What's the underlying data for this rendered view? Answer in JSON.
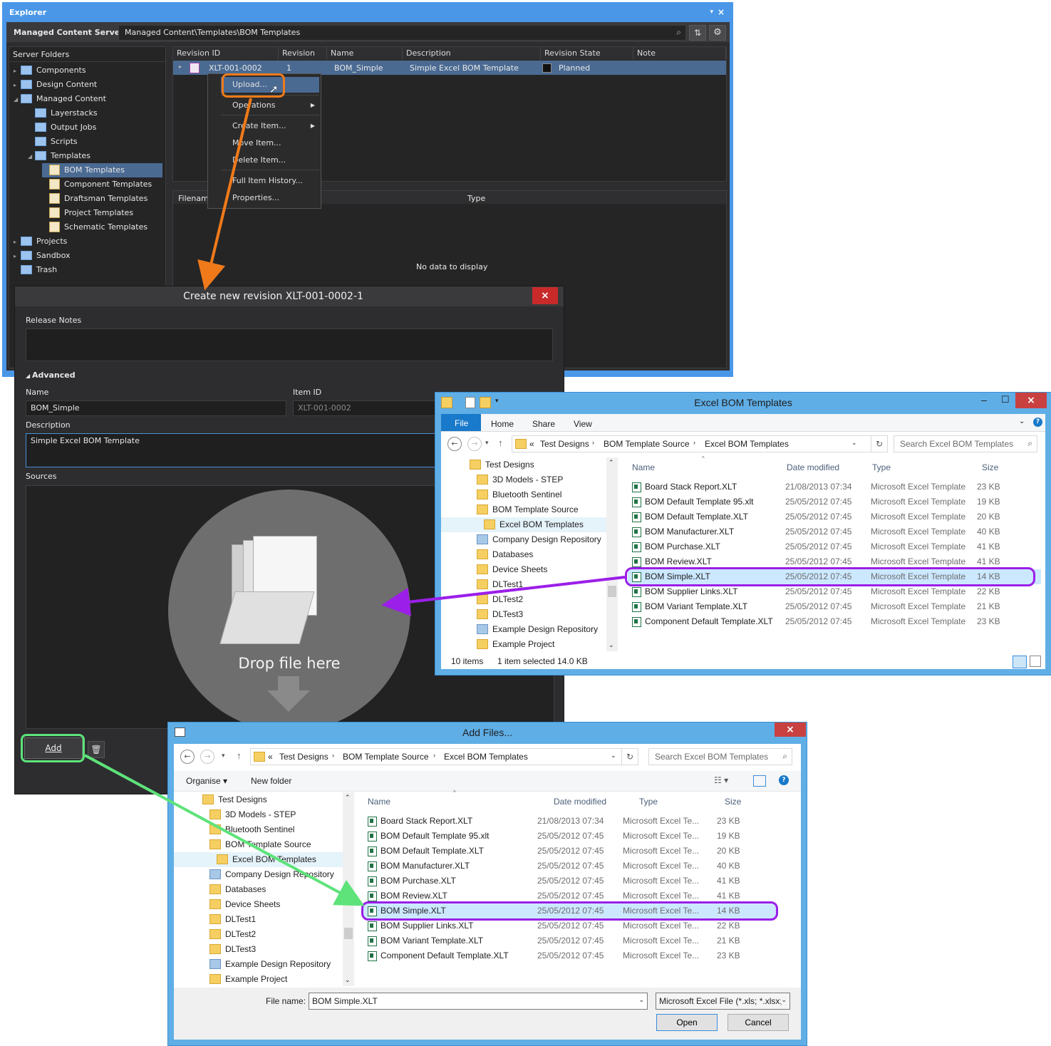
{
  "explorer": {
    "title": "Explorer",
    "server_label": "Managed Content Server ▾",
    "path": "Managed Content\\Templates\\BOM Templates",
    "server_folders_header": "Server Folders",
    "tree": [
      {
        "label": "Components",
        "level": 0
      },
      {
        "label": "Design Content",
        "level": 0
      },
      {
        "label": "Managed Content",
        "level": 0
      },
      {
        "label": "Layerstacks",
        "level": 1
      },
      {
        "label": "Output Jobs",
        "level": 1
      },
      {
        "label": "Scripts",
        "level": 1
      },
      {
        "label": "Templates",
        "level": 1
      },
      {
        "label": "BOM Templates",
        "level": 2
      },
      {
        "label": "Component Templates",
        "level": 2
      },
      {
        "label": "Draftsman Templates",
        "level": 2
      },
      {
        "label": "Project Templates",
        "level": 2
      },
      {
        "label": "Schematic Templates",
        "level": 2
      },
      {
        "label": "Projects",
        "level": 0
      },
      {
        "label": "Sandbox",
        "level": 0
      },
      {
        "label": "Trash",
        "level": 0
      }
    ],
    "columns": [
      "Revision ID",
      "Revision",
      "Name",
      "Description",
      "Revision State",
      "Note"
    ],
    "row": {
      "revision_id": "XLT-001-0002",
      "revision": "1",
      "name": "BOM_Simple",
      "description": "Simple Excel BOM Template",
      "state": "Planned"
    },
    "lower_columns": [
      "Filename",
      "Type"
    ],
    "no_data": "No data to display"
  },
  "context_menu": {
    "items": [
      "Upload...",
      "Operations",
      "Create Item...",
      "Move Item...",
      "Delete Item...",
      "Full Item History...",
      "Properties..."
    ]
  },
  "create_dialog": {
    "title": "Create new revision XLT-001-0002-1",
    "release_notes_label": "Release Notes",
    "advanced_label": "Advanced",
    "name_label": "Name",
    "name_value": "BOM_Simple",
    "item_id_label": "Item ID",
    "item_id_value": "XLT-001-0002",
    "description_label": "Description",
    "description_value": "Simple Excel BOM Template",
    "sources_label": "Sources",
    "drop_text": "Drop file here",
    "add_button": "Add"
  },
  "excel_window": {
    "title": "Excel BOM Templates",
    "ribbon_tabs": [
      "File",
      "Home",
      "Share",
      "View"
    ],
    "breadcrumb": [
      "«",
      "Test Designs",
      "BOM Template Source",
      "Excel BOM Templates"
    ],
    "search_placeholder": "Search Excel BOM Templates",
    "nav_tree": [
      "Test Designs",
      "3D Models - STEP",
      "Bluetooth Sentinel",
      "BOM Template Source",
      "Excel BOM Templates",
      "Company Design Repository",
      "Databases",
      "Device Sheets",
      "DLTest1",
      "DLTest2",
      "DLTest3",
      "Example Design Repository",
      "Example Project"
    ],
    "columns": [
      "Name",
      "Date modified",
      "Type",
      "Size"
    ],
    "files": [
      {
        "name": "Board Stack Report.XLT",
        "date": "21/08/2013 07:34",
        "type": "Microsoft Excel Template",
        "size": "23 KB"
      },
      {
        "name": "BOM Default Template 95.xlt",
        "date": "25/05/2012 07:45",
        "type": "Microsoft Excel Template",
        "size": "19 KB"
      },
      {
        "name": "BOM Default Template.XLT",
        "date": "25/05/2012 07:45",
        "type": "Microsoft Excel Template",
        "size": "20 KB"
      },
      {
        "name": "BOM Manufacturer.XLT",
        "date": "25/05/2012 07:45",
        "type": "Microsoft Excel Template",
        "size": "40 KB"
      },
      {
        "name": "BOM Purchase.XLT",
        "date": "25/05/2012 07:45",
        "type": "Microsoft Excel Template",
        "size": "41 KB"
      },
      {
        "name": "BOM Review.XLT",
        "date": "25/05/2012 07:45",
        "type": "Microsoft Excel Template",
        "size": "41 KB"
      },
      {
        "name": "BOM Simple.XLT",
        "date": "25/05/2012 07:45",
        "type": "Microsoft Excel Template",
        "size": "14 KB"
      },
      {
        "name": "BOM Supplier Links.XLT",
        "date": "25/05/2012 07:45",
        "type": "Microsoft Excel Template",
        "size": "22 KB"
      },
      {
        "name": "BOM Variant Template.XLT",
        "date": "25/05/2012 07:45",
        "type": "Microsoft Excel Template",
        "size": "21 KB"
      },
      {
        "name": "Component Default Template.XLT",
        "date": "25/05/2012 07:45",
        "type": "Microsoft Excel Template",
        "size": "23 KB"
      }
    ],
    "status_items": "10 items",
    "status_selected": "1 item selected  14.0 KB"
  },
  "add_files": {
    "title": "Add Files...",
    "breadcrumb": [
      "«",
      "Test Designs",
      "BOM Template Source",
      "Excel BOM Templates"
    ],
    "search_placeholder": "Search Excel BOM Templates",
    "organise": "Organise ▾",
    "new_folder": "New folder",
    "nav_tree": [
      "Test Designs",
      "3D Models - STEP",
      "Bluetooth Sentinel",
      "BOM Template Source",
      "Excel BOM Templates",
      "Company Design Repository",
      "Databases",
      "Device Sheets",
      "DLTest1",
      "DLTest2",
      "DLTest3",
      "Example Design Repository",
      "Example Project"
    ],
    "columns": [
      "Name",
      "Date modified",
      "Type",
      "Size"
    ],
    "files": [
      {
        "name": "Board Stack Report.XLT",
        "date": "21/08/2013 07:34",
        "type": "Microsoft Excel Te...",
        "size": "23 KB"
      },
      {
        "name": "BOM Default Template 95.xlt",
        "date": "25/05/2012 07:45",
        "type": "Microsoft Excel Te...",
        "size": "19 KB"
      },
      {
        "name": "BOM Default Template.XLT",
        "date": "25/05/2012 07:45",
        "type": "Microsoft Excel Te...",
        "size": "20 KB"
      },
      {
        "name": "BOM Manufacturer.XLT",
        "date": "25/05/2012 07:45",
        "type": "Microsoft Excel Te...",
        "size": "40 KB"
      },
      {
        "name": "BOM Purchase.XLT",
        "date": "25/05/2012 07:45",
        "type": "Microsoft Excel Te...",
        "size": "41 KB"
      },
      {
        "name": "BOM Review.XLT",
        "date": "25/05/2012 07:45",
        "type": "Microsoft Excel Te...",
        "size": "41 KB"
      },
      {
        "name": "BOM Simple.XLT",
        "date": "25/05/2012 07:45",
        "type": "Microsoft Excel Te...",
        "size": "14 KB"
      },
      {
        "name": "BOM Supplier Links.XLT",
        "date": "25/05/2012 07:45",
        "type": "Microsoft Excel Te...",
        "size": "22 KB"
      },
      {
        "name": "BOM Variant Template.XLT",
        "date": "25/05/2012 07:45",
        "type": "Microsoft Excel Te...",
        "size": "21 KB"
      },
      {
        "name": "Component Default Template.XLT",
        "date": "25/05/2012 07:45",
        "type": "Microsoft Excel Te...",
        "size": "23 KB"
      }
    ],
    "file_name_label": "File name:",
    "file_name_value": "BOM Simple.XLT",
    "file_type": "Microsoft Excel File (*.xls; *.xlsx;",
    "open_button": "Open",
    "cancel_button": "Cancel"
  },
  "colors": {
    "accent_orange": "#f07a1a",
    "highlight_purple": "#9b1fe8",
    "highlight_green": "#5ee37a",
    "win_frame": "#5faee6",
    "dark_panel": "#2d2d30"
  }
}
